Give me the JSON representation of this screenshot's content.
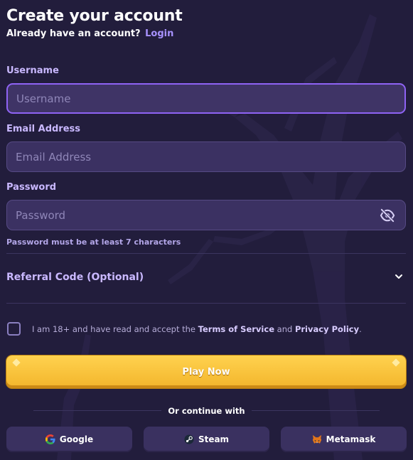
{
  "header": {
    "title": "Create your account",
    "subtitle_prefix": "Already have an account?",
    "login_link": "Login"
  },
  "form": {
    "username": {
      "label": "Username",
      "placeholder": "Username",
      "value": ""
    },
    "email": {
      "label": "Email Address",
      "placeholder": "Email Address",
      "value": ""
    },
    "password": {
      "label": "Password",
      "placeholder": "Password",
      "value": "",
      "hint": "Password must be at least 7 characters",
      "toggle_icon": "eye-off-icon"
    },
    "referral": {
      "label": "Referral Code (Optional)",
      "icon": "chevron-down-icon"
    },
    "terms": {
      "prefix": "I am 18+ and have read and accept the",
      "tos_link": "Terms of Service",
      "and": "and",
      "privacy_link": "Privacy Policy",
      "suffix": ".",
      "checked": false
    },
    "submit_label": "Play Now"
  },
  "social": {
    "divider_text": "Or continue with",
    "buttons": [
      {
        "label": "Google",
        "icon": "google-icon"
      },
      {
        "label": "Steam",
        "icon": "steam-icon"
      },
      {
        "label": "Metamask",
        "icon": "metamask-icon"
      }
    ]
  },
  "colors": {
    "background": "#221d3c",
    "accent": "#8f63f5",
    "link": "#a892ff",
    "button_yellow": "#f3b52b"
  }
}
